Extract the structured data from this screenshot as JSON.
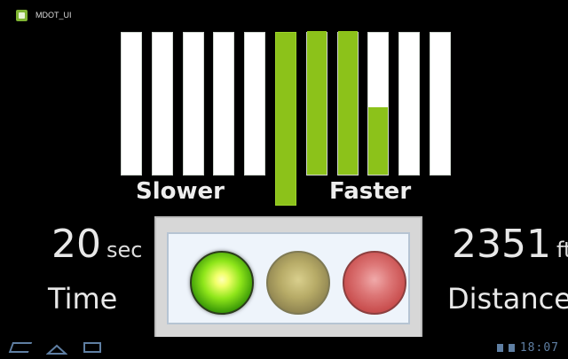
{
  "app": {
    "title": "MDOT_UI"
  },
  "speed_meter": {
    "label_slower": "Slower",
    "label_faster": "Faster",
    "bars": [
      {
        "fill": 0
      },
      {
        "fill": 0
      },
      {
        "fill": 0
      },
      {
        "fill": 0
      },
      {
        "fill": 0
      },
      {
        "fill": 1.0,
        "center": true
      },
      {
        "fill": 1.0
      },
      {
        "fill": 1.0
      },
      {
        "fill": 0.47
      },
      {
        "fill": 0
      },
      {
        "fill": 0
      }
    ],
    "fill_color": "#8cc21a"
  },
  "time": {
    "value": "20",
    "unit": "sec",
    "label": "Time"
  },
  "distance": {
    "value": "2351",
    "unit": "ft",
    "label": "Distance"
  },
  "signal": {
    "active": "green",
    "lights": [
      "green",
      "yellow",
      "red"
    ]
  },
  "status_bar": {
    "clock": "18:07"
  }
}
